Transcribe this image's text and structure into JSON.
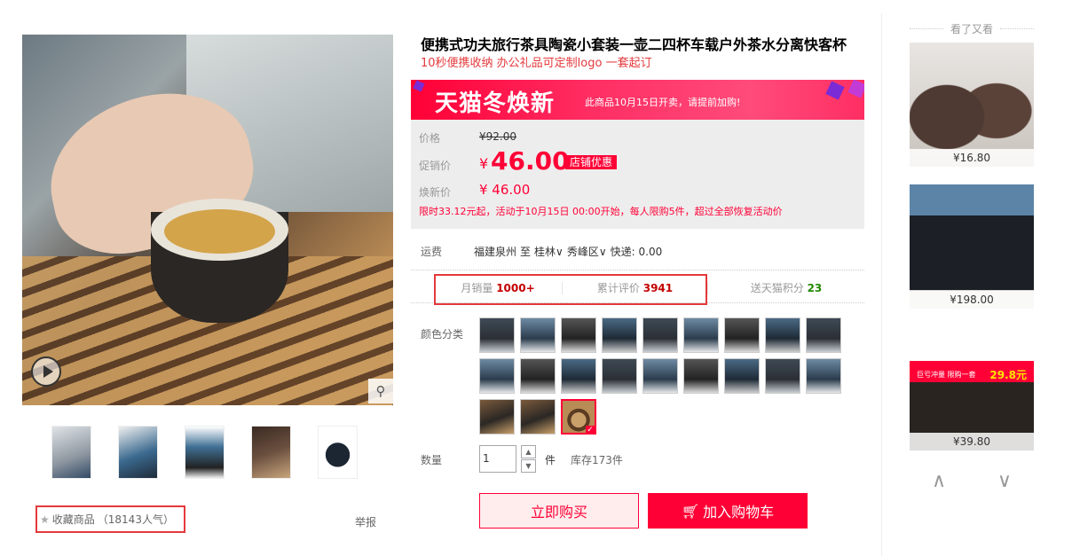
{
  "product": {
    "title": "便携式功夫旅行茶具陶瓷小套装一壶二四杯车载户外茶水分离快客杯",
    "subtitle": "10秒便携收纳 办公礼品可定制logo 一套起订"
  },
  "gallery": {
    "thumbnails": [
      "thumb-1",
      "thumb-2",
      "thumb-3",
      "thumb-4",
      "thumb-5"
    ],
    "collect_label": "收藏商品",
    "collect_count": "（18143人气）",
    "report_label": "举报"
  },
  "promo": {
    "banner_big": "天猫冬焕新",
    "banner_small": "此商品10月15日开卖，请提前加购!"
  },
  "price": {
    "orig_label": "价格",
    "orig_value": "¥92.00",
    "promo_label": "促销价",
    "promo_yen": "¥",
    "promo_value": "46.00",
    "shop_tag": "店铺优惠",
    "renew_label": "焕新价",
    "renew_value": "¥ 46.00",
    "limit_note": "限时33.12元起，活动于10月15日 00:00开始，每人限购5件，超过全部恢复活动价"
  },
  "shipping": {
    "label": "运费",
    "from": "福建泉州",
    "to_word": "至",
    "city": "桂林",
    "district": "秀峰区",
    "express": "快递: 0.00"
  },
  "stats": {
    "monthly_label": "月销量",
    "monthly_value": "1000+",
    "reviews_label": "累计评价",
    "reviews_value": "3941",
    "points_label": "送天猫积分",
    "points_value": "23"
  },
  "color": {
    "label": "颜色分类",
    "swatch_count": 21,
    "selected_index": 20
  },
  "quantity": {
    "label": "数量",
    "value": "1",
    "unit": "件",
    "stock": "库存173件"
  },
  "actions": {
    "buy_now": "立即购买",
    "add_cart": "加入购物车"
  },
  "recommend": {
    "title": "看了又看",
    "items": [
      {
        "price": "¥16.80"
      },
      {
        "price": "¥198.00"
      },
      {
        "price": "¥39.80",
        "promo_text": "巨亏冲量 限购一套",
        "promo_price": "29.8元"
      }
    ]
  },
  "colors": {
    "accent": "#ff0036",
    "highlight_border": "#e4393c"
  }
}
